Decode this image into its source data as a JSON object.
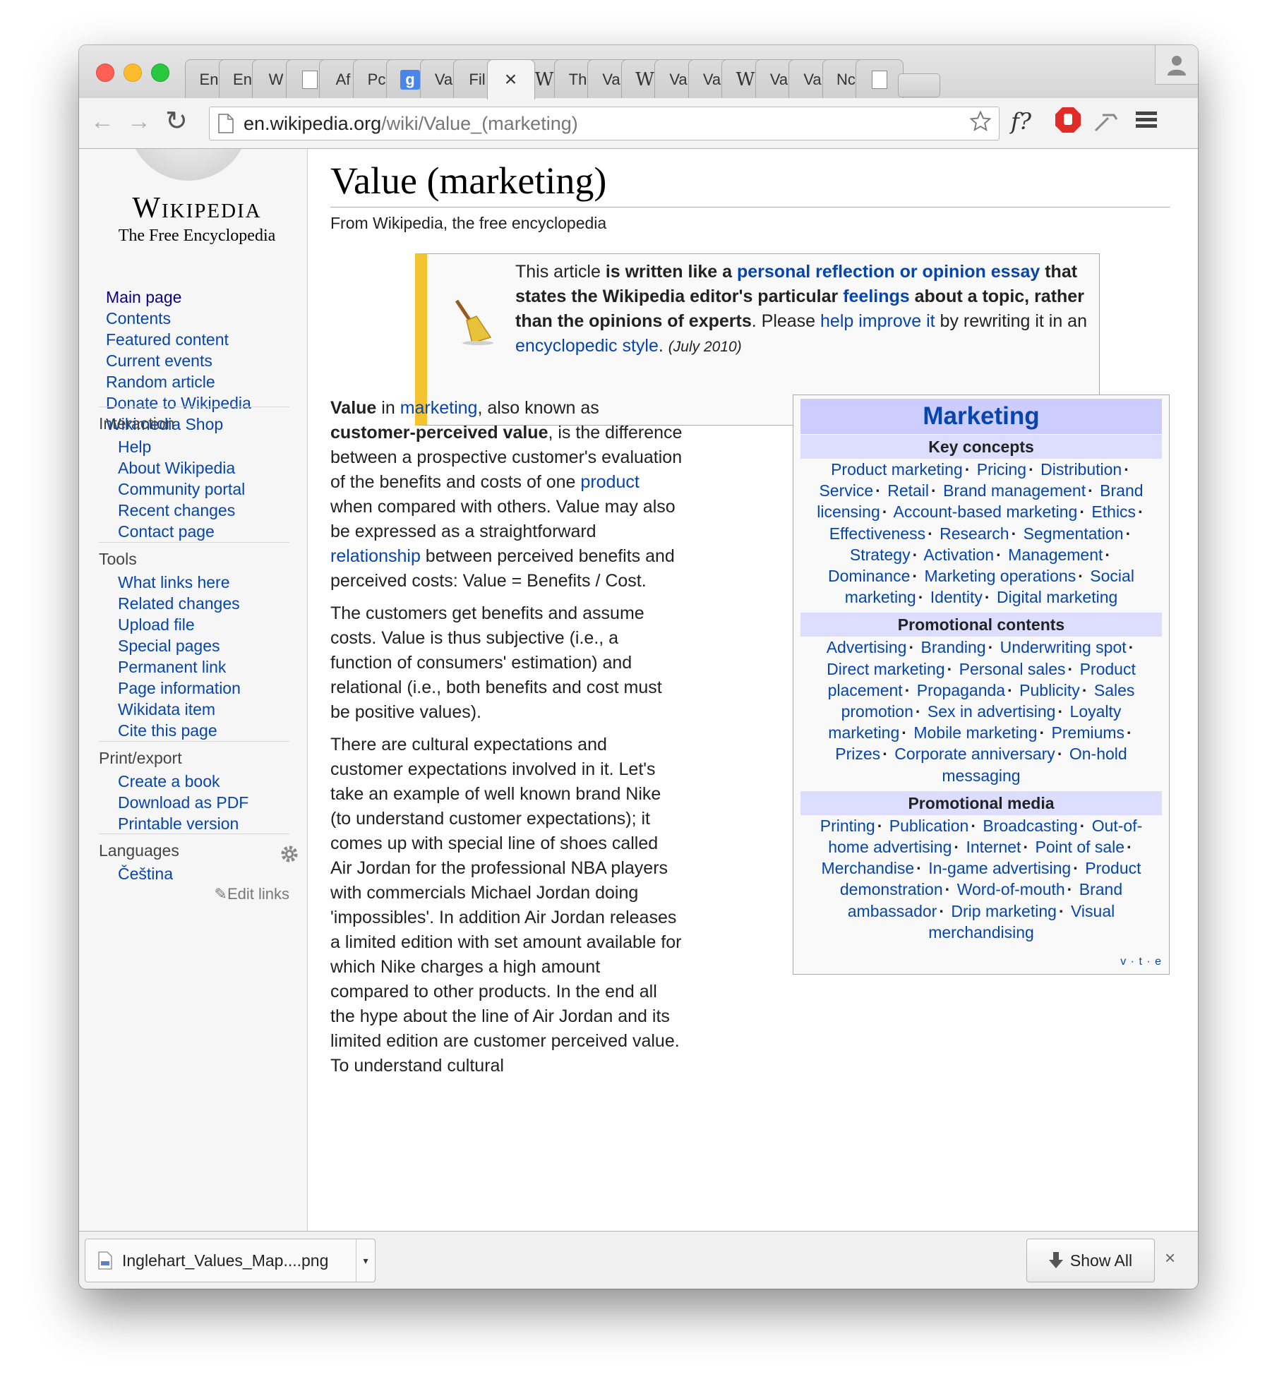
{
  "browser": {
    "tabs": [
      {
        "label": "En",
        "icon": "text"
      },
      {
        "label": "En",
        "icon": "text"
      },
      {
        "label": "W",
        "icon": "text"
      },
      {
        "label": "",
        "icon": "page-icon"
      },
      {
        "label": "Af",
        "icon": "text"
      },
      {
        "label": "Pc",
        "icon": "text"
      },
      {
        "label": "g",
        "icon": "google-icon"
      },
      {
        "label": "Va",
        "icon": "text"
      },
      {
        "label": "Fil",
        "icon": "text"
      },
      {
        "label": "×",
        "icon": "close-icon",
        "active": true
      },
      {
        "label": "W",
        "icon": "wikipedia-icon"
      },
      {
        "label": "Th",
        "icon": "text"
      },
      {
        "label": "Va",
        "icon": "text"
      },
      {
        "label": "W",
        "icon": "wikipedia-icon"
      },
      {
        "label": "Va",
        "icon": "text"
      },
      {
        "label": "Va",
        "icon": "text"
      },
      {
        "label": "W",
        "icon": "wikipedia-icon"
      },
      {
        "label": "Va",
        "icon": "text"
      },
      {
        "label": "Va",
        "icon": "text"
      },
      {
        "label": "Nc",
        "icon": "text"
      },
      {
        "label": "",
        "icon": "page-icon"
      }
    ],
    "url_domain": "en.wikipedia.org",
    "url_path": "/wiki/Value_(marketing)",
    "ext_label": "f?"
  },
  "sidebar": {
    "logo_title": "Wikipedia",
    "logo_tagline": "The Free Encyclopedia",
    "nav": [
      "Main page",
      "Contents",
      "Featured content",
      "Current events",
      "Random article",
      "Donate to Wikipedia",
      "Wikimedia Shop"
    ],
    "interaction": {
      "heading": "Interaction",
      "items": [
        "Help",
        "About Wikipedia",
        "Community portal",
        "Recent changes",
        "Contact page"
      ]
    },
    "tools": {
      "heading": "Tools",
      "items": [
        "What links here",
        "Related changes",
        "Upload file",
        "Special pages",
        "Permanent link",
        "Page information",
        "Wikidata item",
        "Cite this page"
      ]
    },
    "print": {
      "heading": "Print/export",
      "items": [
        "Create a book",
        "Download as PDF",
        "Printable version"
      ]
    },
    "languages": {
      "heading": "Languages",
      "items": [
        "Čeština"
      ],
      "edit_links": "Edit links"
    }
  },
  "article": {
    "title": "Value (marketing)",
    "from": "From Wikipedia, the free encyclopedia",
    "notice": {
      "t1": "This article ",
      "t2": "is written like a ",
      "link1": "personal reflection or opinion essay",
      "t3": " that states the Wikipedia editor's particular ",
      "link2": "feelings",
      "t4": " about a topic, rather than the opinions of experts",
      "t5": ". Please ",
      "link3": "help improve it",
      "t6": " by rewriting it in an ",
      "link4": "encyclopedic style",
      "t7": ".",
      "date": "(July 2010)"
    },
    "p1": {
      "b1": "Value",
      "t1": " in ",
      "l1": "marketing",
      "t2": ", also known as ",
      "b2": "customer-perceived value",
      "t3": ", is the difference between a prospective customer's evaluation of the benefits and costs of one ",
      "l2": "product",
      "t4": " when compared with others. Value may also be expressed as a straightforward ",
      "l3": "relationship",
      "t5": " between perceived benefits and perceived costs: Value = Benefits / Cost."
    },
    "p2": "The customers get benefits and assume costs. Value is thus subjective (i.e., a function of consumers' estimation) and relational (i.e., both benefits and cost must be positive values).",
    "p3": "There are cultural expectations and customer expectations involved in it. Let's take an example of well known brand Nike (to understand customer expectations); it comes up with special line of shoes called Air Jordan for the professional NBA players with commercials Michael Jordan doing 'impossibles'. In addition Air Jordan releases a limited edition with set amount available for which Nike charges a high amount compared to other products. In the end all the hype about the line of Air Jordan and its limited edition are customer perceived value. To understand cultural"
  },
  "navbox": {
    "title": "Marketing",
    "groups": [
      {
        "heading": "Key concepts",
        "links": [
          "Product marketing",
          "Pricing",
          "Distribution",
          "Service",
          "Retail",
          "Brand management",
          "Brand licensing",
          "Account-based marketing",
          "Ethics",
          "Effectiveness",
          "Research",
          "Segmentation",
          "Strategy",
          "Activation",
          "Management",
          "Dominance",
          "Marketing operations",
          "Social marketing",
          "Identity",
          "Digital marketing"
        ]
      },
      {
        "heading": "Promotional contents",
        "links": [
          "Advertising",
          "Branding",
          "Underwriting spot",
          "Direct marketing",
          "Personal sales",
          "Product placement",
          "Propaganda",
          "Publicity",
          "Sales promotion",
          "Sex in advertising",
          "Loyalty marketing",
          "Mobile marketing",
          "Premiums",
          "Prizes",
          "Corporate anniversary",
          "On-hold messaging"
        ]
      },
      {
        "heading": "Promotional media",
        "links": [
          "Printing",
          "Publication",
          "Broadcasting",
          "Out-of-home advertising",
          "Internet",
          "Point of sale",
          "Merchandise",
          "In-game advertising",
          "Product demonstration",
          "Word-of-mouth",
          "Brand ambassador",
          "Drip marketing",
          "Visual merchandising"
        ]
      }
    ],
    "vte": "v · t · e"
  },
  "downloads": {
    "file": "Inglehart_Values_Map....png",
    "show_all": "Show All",
    "close": "×"
  }
}
